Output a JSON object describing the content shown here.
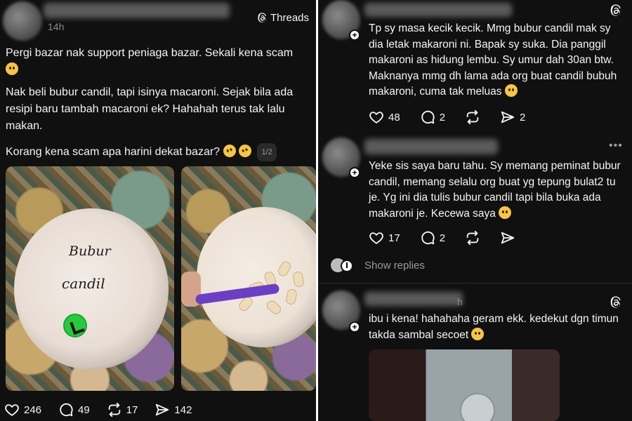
{
  "left_post": {
    "time": "14h",
    "badge_label": "Threads",
    "paragraph1": "Pergi bazar nak support peniaga bazar. Sekali kena scam",
    "paragraph2": "Nak beli bubur candil, tapi isinya macaroni.  Sejak bila ada resipi baru tambah macaroni ek? Hahahah terus tak lalu makan.",
    "paragraph3": "Korang kena scam apa harini dekat bazar?",
    "pager": "1/2",
    "photo_label_line1": "Bubur",
    "photo_label_line2": "candil",
    "likes": "246",
    "comments": "49",
    "reposts": "17",
    "shares": "142"
  },
  "right_thread": {
    "reply1": {
      "text": "Tp sy masa kecik kecik. Mmg bubur candil mak sy dia letak makaroni ni. Bapak sy suka. Dia panggil makaroni as hidung lembu. Sy umur dah 30an btw. Maknanya mmg dh lama ada org buat candil bubuh makaroni, cuma tak meluas",
      "likes": "48",
      "comments": "2",
      "shares": "2"
    },
    "reply2": {
      "text": "Yeke sis saya baru tahu. Sy memang peminat bubur candil, memang selalu org buat yg tepung bulat2 tu je. Yg ini dia tulis bubur candil tapi bila buka ada makaroni je. Kecewa saya",
      "likes": "17",
      "comments": "2"
    },
    "show_replies": "Show replies",
    "reply3": {
      "time_suffix": "h",
      "text": "ibu i kena! hahahaha geram ekk. kedekut dgn timun takda sambal secoet"
    }
  },
  "icons": {
    "heart": "heart-icon",
    "comment": "comment-icon",
    "repost": "repost-icon",
    "share": "share-icon",
    "threads": "threads-icon"
  }
}
